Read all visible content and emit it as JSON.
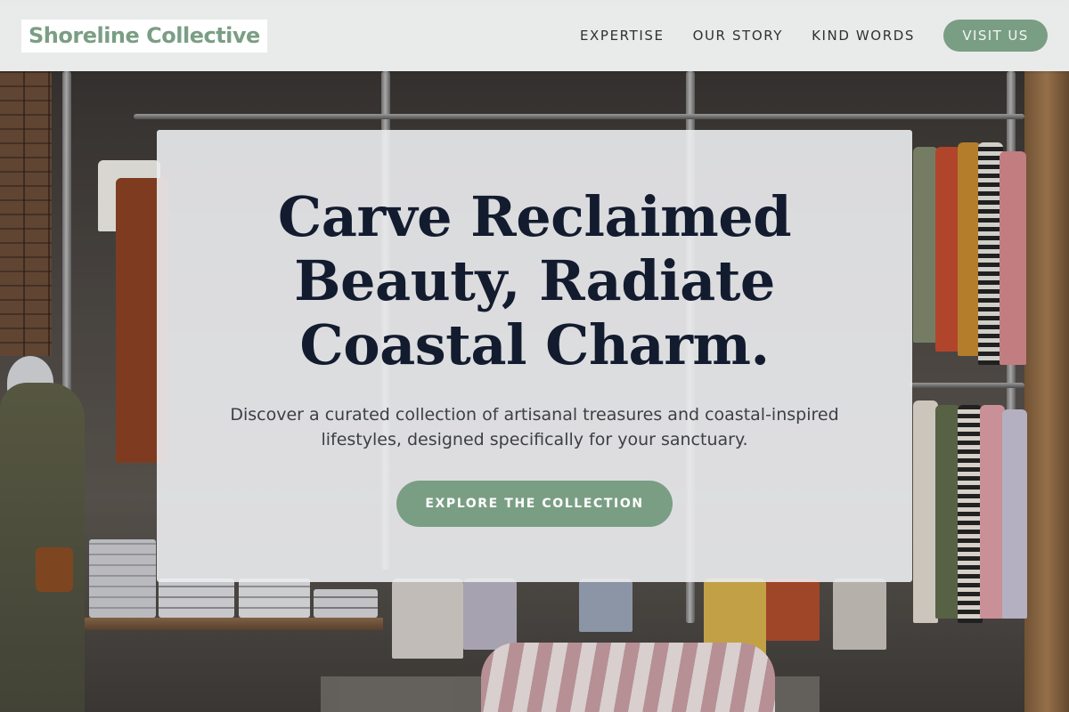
{
  "brand": {
    "name": "Shoreline Collective",
    "accent": "#7a9e84"
  },
  "nav": {
    "links": [
      "EXPERTISE",
      "OUR STORY",
      "KIND WORDS"
    ],
    "cta": "VISIT US"
  },
  "hero": {
    "title": "Carve Reclaimed Beauty, Radiate Coastal Charm.",
    "subtitle": "Discover a curated collection of artisanal treasures and coastal-inspired lifestyles, designed specifically for your sanctuary.",
    "cta": "EXPLORE THE COLLECTION"
  },
  "colors": {
    "title": "#131c2f",
    "header_bg": "#f0f2f3",
    "card_bg": "#ecedef"
  }
}
